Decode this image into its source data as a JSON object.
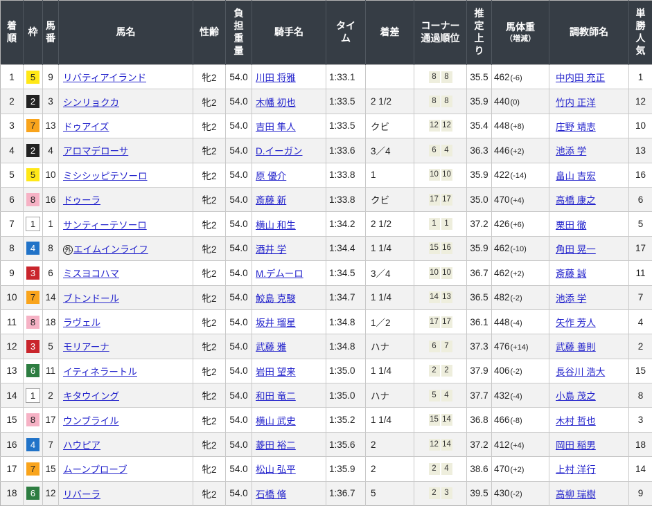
{
  "table": {
    "headers": [
      {
        "id": "rank",
        "label": "着\n順"
      },
      {
        "id": "waku",
        "label": "枠"
      },
      {
        "id": "num",
        "label": "馬\n番"
      },
      {
        "id": "horse",
        "label": "馬名"
      },
      {
        "id": "sexage",
        "label": "性齢"
      },
      {
        "id": "carried",
        "label": "負\n担\n重\n量"
      },
      {
        "id": "jockey",
        "label": "騎手名"
      },
      {
        "id": "time",
        "label": "タイ\nム"
      },
      {
        "id": "margin",
        "label": "着差"
      },
      {
        "id": "corners",
        "label": "コーナー\n通過順位"
      },
      {
        "id": "last3f",
        "label": "推\n定\n上\nり"
      },
      {
        "id": "bodyweight",
        "label": "馬体重",
        "sub": "（増減）"
      },
      {
        "id": "trainer",
        "label": "調教師名"
      },
      {
        "id": "fav",
        "label": "単\n勝\n人\n気"
      }
    ],
    "rows": [
      {
        "rank": "1",
        "waku": "5",
        "num": "9",
        "horse": "リバティアイランド",
        "sexage": "牝2",
        "carried": "54.0",
        "jockey": "川田 将雅",
        "time": "1:33.1",
        "margin": "",
        "corners": [
          "8",
          "8"
        ],
        "last3f": "35.5",
        "weight": "462",
        "weight_diff": "(-6)",
        "trainer": "中内田 充正",
        "fav": "1"
      },
      {
        "rank": "2",
        "waku": "2",
        "num": "3",
        "horse": "シンリョクカ",
        "sexage": "牝2",
        "carried": "54.0",
        "jockey": "木幡 初也",
        "time": "1:33.5",
        "margin": "2 1/2",
        "corners": [
          "8",
          "8"
        ],
        "last3f": "35.9",
        "weight": "440",
        "weight_diff": "(0)",
        "trainer": "竹内 正洋",
        "fav": "12"
      },
      {
        "rank": "3",
        "waku": "7",
        "num": "13",
        "horse": "ドゥアイズ",
        "sexage": "牝2",
        "carried": "54.0",
        "jockey": "吉田 隼人",
        "time": "1:33.5",
        "margin": "クビ",
        "corners": [
          "12",
          "12"
        ],
        "last3f": "35.4",
        "weight": "448",
        "weight_diff": "(+8)",
        "trainer": "庄野 靖志",
        "fav": "10"
      },
      {
        "rank": "4",
        "waku": "2",
        "num": "4",
        "horse": "アロマデローサ",
        "sexage": "牝2",
        "carried": "54.0",
        "jockey": "D.イーガン",
        "time": "1:33.6",
        "margin": "3／4",
        "corners": [
          "6",
          "4"
        ],
        "last3f": "36.3",
        "weight": "446",
        "weight_diff": "(+2)",
        "trainer": "池添 学",
        "fav": "13"
      },
      {
        "rank": "5",
        "waku": "5",
        "num": "10",
        "horse": "ミシシッピテソーロ",
        "sexage": "牝2",
        "carried": "54.0",
        "jockey": "原 優介",
        "time": "1:33.8",
        "margin": "1",
        "corners": [
          "10",
          "10"
        ],
        "last3f": "35.9",
        "weight": "422",
        "weight_diff": "(-14)",
        "trainer": "畠山 吉宏",
        "fav": "16"
      },
      {
        "rank": "6",
        "waku": "8",
        "num": "16",
        "horse": "ドゥーラ",
        "sexage": "牝2",
        "carried": "54.0",
        "jockey": "斎藤 新",
        "time": "1:33.8",
        "margin": "クビ",
        "corners": [
          "17",
          "17"
        ],
        "last3f": "35.0",
        "weight": "470",
        "weight_diff": "(+4)",
        "trainer": "高橋 康之",
        "fav": "6"
      },
      {
        "rank": "7",
        "waku": "1",
        "num": "1",
        "horse": "サンティーテソーロ",
        "sexage": "牝2",
        "carried": "54.0",
        "jockey": "横山 和生",
        "time": "1:34.2",
        "margin": "2 1/2",
        "corners": [
          "1",
          "1"
        ],
        "last3f": "37.2",
        "weight": "426",
        "weight_diff": "(+6)",
        "trainer": "栗田 徹",
        "fav": "5"
      },
      {
        "rank": "8",
        "waku": "4",
        "num": "8",
        "mark": "外",
        "horse": "エイムインライフ",
        "sexage": "牝2",
        "carried": "54.0",
        "jockey": "酒井 学",
        "time": "1:34.4",
        "margin": "1 1/4",
        "corners": [
          "15",
          "16"
        ],
        "last3f": "35.9",
        "weight": "462",
        "weight_diff": "(-10)",
        "trainer": "角田 晃一",
        "fav": "17"
      },
      {
        "rank": "9",
        "waku": "3",
        "num": "6",
        "horse": "ミスヨコハマ",
        "sexage": "牝2",
        "carried": "54.0",
        "jockey": "M.デムーロ",
        "time": "1:34.5",
        "margin": "3／4",
        "corners": [
          "10",
          "10"
        ],
        "last3f": "36.7",
        "weight": "462",
        "weight_diff": "(+2)",
        "trainer": "斎藤 誠",
        "fav": "11"
      },
      {
        "rank": "10",
        "waku": "7",
        "num": "14",
        "horse": "ブトンドール",
        "sexage": "牝2",
        "carried": "54.0",
        "jockey": "鮫島 克駿",
        "time": "1:34.7",
        "margin": "1 1/4",
        "corners": [
          "14",
          "13"
        ],
        "last3f": "36.5",
        "weight": "482",
        "weight_diff": "(-2)",
        "trainer": "池添 学",
        "fav": "7"
      },
      {
        "rank": "11",
        "waku": "8",
        "num": "18",
        "horse": "ラヴェル",
        "sexage": "牝2",
        "carried": "54.0",
        "jockey": "坂井 瑠星",
        "time": "1:34.8",
        "margin": "1／2",
        "corners": [
          "17",
          "17"
        ],
        "last3f": "36.1",
        "weight": "448",
        "weight_diff": "(-4)",
        "trainer": "矢作 芳人",
        "fav": "4"
      },
      {
        "rank": "12",
        "waku": "3",
        "num": "5",
        "horse": "モリアーナ",
        "sexage": "牝2",
        "carried": "54.0",
        "jockey": "武藤 雅",
        "time": "1:34.8",
        "margin": "ハナ",
        "corners": [
          "6",
          "7"
        ],
        "last3f": "37.3",
        "weight": "476",
        "weight_diff": "(+14)",
        "trainer": "武藤 善則",
        "fav": "2"
      },
      {
        "rank": "13",
        "waku": "6",
        "num": "11",
        "horse": "イティネラートル",
        "sexage": "牝2",
        "carried": "54.0",
        "jockey": "岩田 望来",
        "time": "1:35.0",
        "margin": "1 1/4",
        "corners": [
          "2",
          "2"
        ],
        "last3f": "37.9",
        "weight": "406",
        "weight_diff": "(-2)",
        "trainer": "長谷川 浩大",
        "fav": "15"
      },
      {
        "rank": "14",
        "waku": "1",
        "num": "2",
        "horse": "キタウイング",
        "sexage": "牝2",
        "carried": "54.0",
        "jockey": "和田 竜二",
        "time": "1:35.0",
        "margin": "ハナ",
        "corners": [
          "5",
          "4"
        ],
        "last3f": "37.7",
        "weight": "432",
        "weight_diff": "(-4)",
        "trainer": "小島 茂之",
        "fav": "8"
      },
      {
        "rank": "15",
        "waku": "8",
        "num": "17",
        "horse": "ウンブライル",
        "sexage": "牝2",
        "carried": "54.0",
        "jockey": "横山 武史",
        "time": "1:35.2",
        "margin": "1 1/4",
        "corners": [
          "15",
          "14"
        ],
        "last3f": "36.8",
        "weight": "466",
        "weight_diff": "(-8)",
        "trainer": "木村 哲也",
        "fav": "3"
      },
      {
        "rank": "16",
        "waku": "4",
        "num": "7",
        "horse": "ハウピア",
        "sexage": "牝2",
        "carried": "54.0",
        "jockey": "菱田 裕二",
        "time": "1:35.6",
        "margin": "2",
        "corners": [
          "12",
          "14"
        ],
        "last3f": "37.2",
        "weight": "412",
        "weight_diff": "(+4)",
        "trainer": "岡田 稲男",
        "fav": "18"
      },
      {
        "rank": "17",
        "waku": "7",
        "num": "15",
        "horse": "ムーンプローブ",
        "sexage": "牝2",
        "carried": "54.0",
        "jockey": "松山 弘平",
        "time": "1:35.9",
        "margin": "2",
        "corners": [
          "2",
          "4"
        ],
        "last3f": "38.6",
        "weight": "470",
        "weight_diff": "(+2)",
        "trainer": "上村 洋行",
        "fav": "14"
      },
      {
        "rank": "18",
        "waku": "6",
        "num": "12",
        "horse": "リバーラ",
        "sexage": "牝2",
        "carried": "54.0",
        "jockey": "石橋 脩",
        "time": "1:36.7",
        "margin": "5",
        "corners": [
          "2",
          "3"
        ],
        "last3f": "39.5",
        "weight": "430",
        "weight_diff": "(-2)",
        "trainer": "高柳 瑞樹",
        "fav": "9"
      }
    ]
  },
  "colors": {
    "header_bg": "#363d45",
    "row_alt_bg": "#f2f2f2",
    "grid_line": "#c9c9c9",
    "link": "#2323cc",
    "corner_box_bg": "#eeeedd",
    "waku": {
      "1": {
        "bg": "#ffffff",
        "fg": "#222222",
        "border": "#a0a0a0"
      },
      "2": {
        "bg": "#222222",
        "fg": "#ffffff"
      },
      "3": {
        "bg": "#c9252c",
        "fg": "#ffffff"
      },
      "4": {
        "bg": "#2173c8",
        "fg": "#ffffff"
      },
      "5": {
        "bg": "#ffe817",
        "fg": "#222222"
      },
      "6": {
        "bg": "#2d7d41",
        "fg": "#ffffff"
      },
      "7": {
        "bg": "#f9a41c",
        "fg": "#222222"
      },
      "8": {
        "bg": "#f6b2c5",
        "fg": "#222222"
      }
    }
  }
}
